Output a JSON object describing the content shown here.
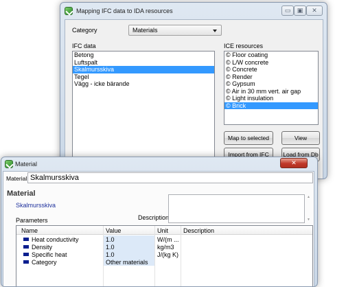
{
  "mapping_window": {
    "title": "Mapping IFC data to IDA resources",
    "category_label": "Category",
    "category_value": "Materials",
    "ifc_data_label": "IFC data",
    "ice_resources_label": "ICE resources",
    "ifc_items": [
      "Betong",
      "Luftspalt",
      "Skalmursskiva",
      "Tegel",
      "Vägg - icke bärande"
    ],
    "ifc_selected_index": 2,
    "ice_items": [
      "© Floor coating",
      "© L/W concrete",
      "© Concrete",
      "© Render",
      "© Gypsum",
      "© Air in 30 mm vert. air gap",
      "© Light insulation",
      "© Brick"
    ],
    "ice_selected_index": 7,
    "buttons": {
      "map_to_selected": "Map to selected",
      "view": "View",
      "import_from_ifc": "Import from IFC",
      "load_from_db": "Load from Db"
    }
  },
  "material_window": {
    "title": "Material",
    "material_label": "Material",
    "material_value": "Skalmursskiva",
    "section_heading": "Material",
    "material_name_link": "Skalmursskiva",
    "description_label": "Description",
    "parameters_label": "Parameters",
    "columns": [
      "Name",
      "Value",
      "Unit",
      "Description"
    ],
    "rows": [
      {
        "name": "Heat conductivity",
        "value": "1.0",
        "unit": "W/(m ...",
        "description": ""
      },
      {
        "name": "Density",
        "value": "1.0",
        "unit": "kg/m3",
        "description": ""
      },
      {
        "name": "Specific heat",
        "value": "1.0",
        "unit": "J/(kg K)",
        "description": ""
      },
      {
        "name": "Category",
        "value": "Other materials",
        "unit": "",
        "description": ""
      }
    ]
  },
  "colors": {
    "selection": "#3399ff",
    "link_text": "#1c2f9c",
    "param_swatch": "#0b1f8f"
  }
}
